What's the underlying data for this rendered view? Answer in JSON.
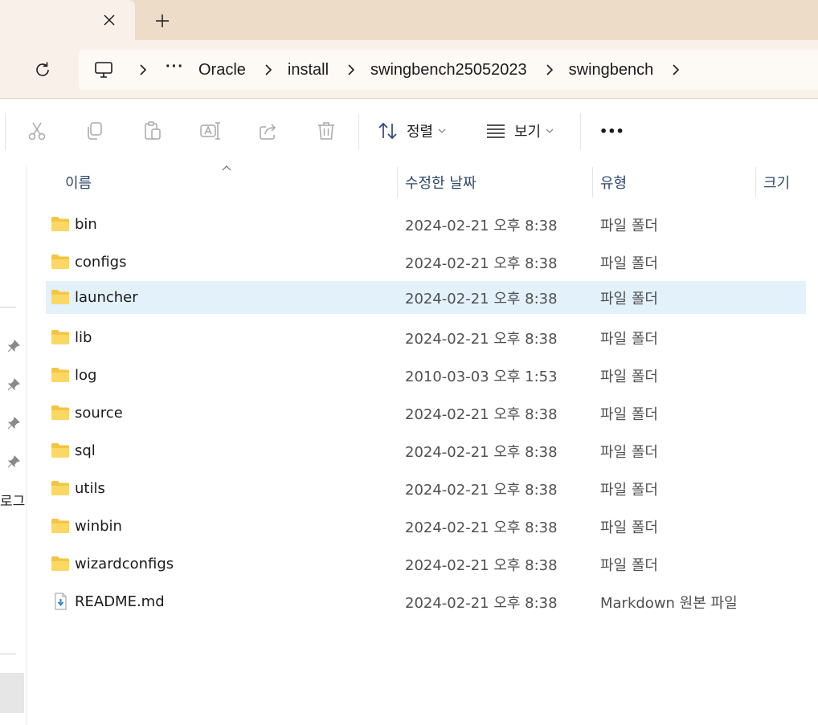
{
  "tabs": {
    "new_tab_label": "+"
  },
  "address": {
    "ellipsis": "···",
    "crumbs": [
      "Oracle",
      "install",
      "swingbench25052023",
      "swingbench"
    ]
  },
  "toolbar": {
    "sort_label": "정렬",
    "view_label": "보기",
    "more_label": "•••"
  },
  "columns": {
    "name": "이름",
    "modified": "수정한 날짜",
    "type": "유형",
    "size": "크기"
  },
  "nav": {
    "clipped_label": "로그륨"
  },
  "files": [
    {
      "name": "bin",
      "modified": "2024-02-21 오후 8:38",
      "type": "파일 폴더",
      "icon": "folder-icon"
    },
    {
      "name": "configs",
      "modified": "2024-02-21 오후 8:38",
      "type": "파일 폴더",
      "icon": "folder-icon"
    },
    {
      "name": "launcher",
      "modified": "2024-02-21 오후 8:38",
      "type": "파일 폴더",
      "icon": "folder-icon"
    },
    {
      "name": "lib",
      "modified": "2024-02-21 오후 8:38",
      "type": "파일 폴더",
      "icon": "folder-icon"
    },
    {
      "name": "log",
      "modified": "2010-03-03 오후 1:53",
      "type": "파일 폴더",
      "icon": "folder-icon"
    },
    {
      "name": "source",
      "modified": "2024-02-21 오후 8:38",
      "type": "파일 폴더",
      "icon": "folder-icon"
    },
    {
      "name": "sql",
      "modified": "2024-02-21 오후 8:38",
      "type": "파일 폴더",
      "icon": "folder-icon"
    },
    {
      "name": "utils",
      "modified": "2024-02-21 오후 8:38",
      "type": "파일 폴더",
      "icon": "folder-icon"
    },
    {
      "name": "winbin",
      "modified": "2024-02-21 오후 8:38",
      "type": "파일 폴더",
      "icon": "folder-icon"
    },
    {
      "name": "wizardconfigs",
      "modified": "2024-02-21 오후 8:38",
      "type": "파일 폴더",
      "icon": "folder-icon"
    },
    {
      "name": "README.md",
      "modified": "2024-02-21 오후 8:38",
      "type": "Markdown 원본 파일",
      "icon": "markdown-file-icon"
    }
  ],
  "selected_row": "launcher",
  "colors": {
    "tab_strip": "#ecdcc8",
    "address_bg": "#f9f1e9",
    "selection": "#e3f1fb",
    "folder": "#f4c542"
  }
}
